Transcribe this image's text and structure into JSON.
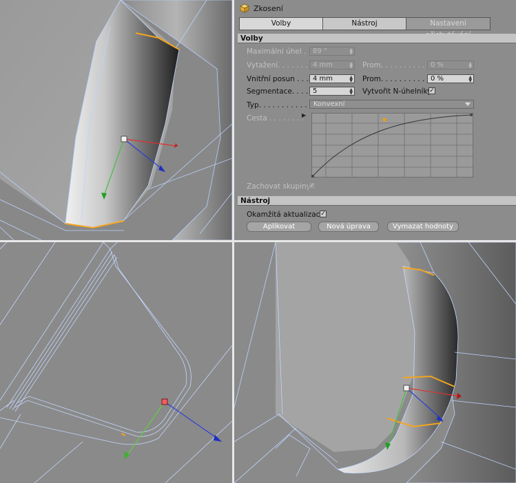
{
  "panel": {
    "title": "Zkosení",
    "icon": "cube-icon",
    "tabs": [
      "Volby",
      "Nástroj",
      "Nastavení přichytávání"
    ],
    "volby": {
      "header": "Volby",
      "max_angle": {
        "label": "Maximální úhel . .",
        "value": "89 °"
      },
      "extrusion": {
        "label": "Vytažení. . . . . . . .",
        "value": "4 mm"
      },
      "extrusion_prom": {
        "label": "Prom. . . . . . . . . . . . .",
        "value": "0 %"
      },
      "inner_offset": {
        "label": "Vnitřní posun . . .",
        "value": "4 mm"
      },
      "inner_prom": {
        "label": "Prom. . . . . . . . . . . . .",
        "value": "0 %"
      },
      "subdivision": {
        "label": "Segmentace. . . .",
        "value": "5"
      },
      "create_ngons": {
        "label": "Vytvořit N-úhelníky",
        "checked": true
      },
      "type": {
        "label": "Typ. . . . . . . . . . .",
        "value": "Konvexní"
      },
      "path": {
        "label": "Cesta . . . . . . . ."
      },
      "preserve_groups": {
        "label": "Zachovat skupiny",
        "checked": true
      }
    },
    "nastroj": {
      "header": "Nástroj",
      "realtime_update": {
        "label": "Okamžitá aktualizace",
        "checked": true
      },
      "apply_button": "Aplikovat",
      "new_transform_button": "Nová úprava",
      "reset_values_button": "Vymazat hodnoty"
    }
  },
  "viewports": [
    "top-left-perspective",
    "bottom-left-perspective",
    "bottom-right-perspective"
  ]
}
